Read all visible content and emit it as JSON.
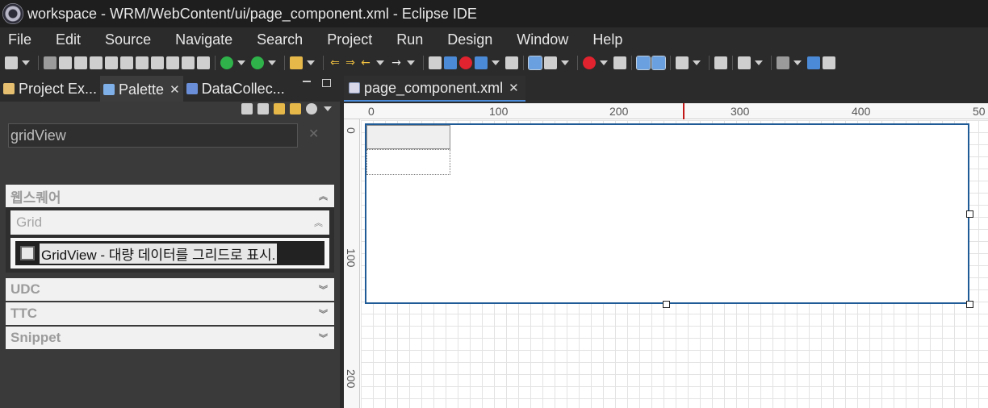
{
  "window": {
    "title": "workspace - WRM/WebContent/ui/page_component.xml - Eclipse IDE"
  },
  "menu": [
    "File",
    "Edit",
    "Source",
    "Navigate",
    "Search",
    "Project",
    "Run",
    "Design",
    "Window",
    "Help"
  ],
  "left_panel": {
    "tabs": [
      {
        "label": "Project Ex...",
        "icon": "project-explorer-icon"
      },
      {
        "label": "Palette",
        "icon": "palette-icon",
        "close": "✕"
      },
      {
        "label": "DataCollec...",
        "icon": "data-collection-icon"
      }
    ],
    "search": {
      "value": "gridView",
      "clear": "✕"
    },
    "drawers": {
      "websquare": {
        "label": "웹스퀘어",
        "chevron": "︽"
      },
      "grid_group": {
        "label": "Grid",
        "chevron": "︽"
      },
      "entry": {
        "label": "GridView - 대량 데이터를 그리드로 표시.",
        "icon": "gridview-icon"
      },
      "udc": {
        "label": "UDC",
        "chevron": "︾"
      },
      "ttc": {
        "label": "TTC",
        "chevron": "︾"
      },
      "snippet": {
        "label": "Snippet",
        "chevron": "︾"
      }
    }
  },
  "editor": {
    "tab": {
      "label": "page_component.xml",
      "close": "✕",
      "icon": "xml-file-icon"
    },
    "ruler_top": [
      "0",
      "100",
      "200",
      "300",
      "400",
      "50"
    ],
    "ruler_left": [
      "0",
      "100",
      "200"
    ]
  },
  "colors": {
    "selection_border": "#1f5b96",
    "ruler_marker": "#c21818",
    "tab_underline": "#4a8ad6"
  }
}
